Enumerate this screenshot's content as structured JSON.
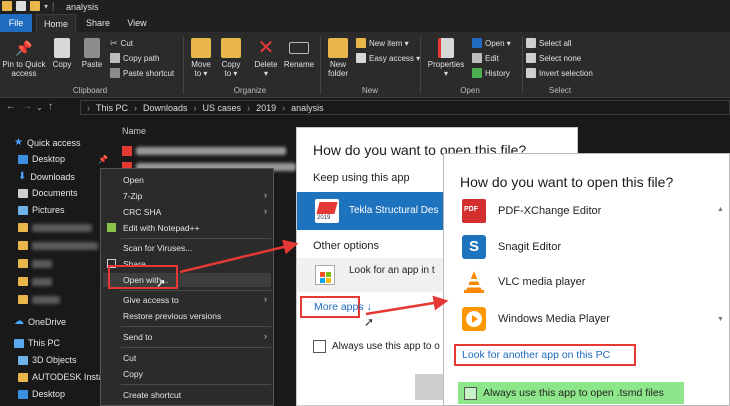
{
  "titlebar": {
    "title": "analysis"
  },
  "tabs": {
    "file": "File",
    "home": "Home",
    "share": "Share",
    "view": "View"
  },
  "ribbon": {
    "clipboard": {
      "pin": "Pin to Quick\naccess",
      "copy": "Copy",
      "paste": "Paste",
      "cut": "Cut",
      "copy_path": "Copy path",
      "paste_shortcut": "Paste shortcut",
      "group_label": "Clipboard"
    },
    "organize": {
      "move_to": "Move\nto ▾",
      "copy_to": "Copy\nto ▾",
      "delete": "Delete\n▾",
      "rename": "Rename",
      "group_label": "Organize"
    },
    "new": {
      "new_folder": "New\nfolder",
      "new_item": "New item ▾",
      "easy_access": "Easy access ▾",
      "group_label": "New"
    },
    "open": {
      "properties": "Properties\n▾",
      "open": "Open ▾",
      "edit": "Edit",
      "history": "History",
      "group_label": "Open"
    },
    "select": {
      "select_all": "Select all",
      "select_none": "Select none",
      "invert_selection": "Invert selection",
      "group_label": "Select"
    },
    "colors": {
      "accent": "#1e6bbf",
      "folder": "#e8b64a",
      "delete": "#e53935"
    }
  },
  "address": {
    "crumbs": [
      "This PC",
      "Downloads",
      "US cases",
      "2019",
      "analysis"
    ]
  },
  "navpane": {
    "quick_access": "Quick access",
    "desktop": "Desktop",
    "downloads": "Downloads",
    "documents": "Documents",
    "pictures": "Pictures",
    "onedrive": "OneDrive",
    "this_pc": "This PC",
    "objects3d": "3D Objects",
    "autodesk": "AUTODESK Install",
    "desktop2": "Desktop"
  },
  "filelist": {
    "name_header": "Name"
  },
  "context_menu": {
    "open": "Open",
    "zip": "7-Zip",
    "crc": "CRC SHA",
    "notepad": "Edit with Notepad++",
    "scan": "Scan for Viruses...",
    "share": "Share",
    "open_with": "Open with...",
    "give_access": "Give access to",
    "restore": "Restore previous versions",
    "send_to": "Send to",
    "cut": "Cut",
    "copy": "Copy",
    "create_shortcut": "Create shortcut"
  },
  "dialog1": {
    "title": "How do you want to open this file?",
    "keep_using": "Keep using this app",
    "app_name": "Tekla Structural Des",
    "app_badge": "2019",
    "other_options": "Other options",
    "look_for_app": "Look for an app in t",
    "more_apps": "More apps  ↓",
    "always_use": "Always use this app to o"
  },
  "dialog2": {
    "title": "How do you want to open this file?",
    "apps": [
      {
        "name": "PDF-XChange Editor",
        "icon": "pdf-xchange-icon",
        "badge": "PDF"
      },
      {
        "name": "Snagit Editor",
        "icon": "snagit-icon",
        "badge": "S"
      },
      {
        "name": "VLC media player",
        "icon": "vlc-icon",
        "badge": ""
      },
      {
        "name": "Windows Media Player",
        "icon": "windows-media-player-icon",
        "badge": ""
      }
    ],
    "look_another": "Look for another app on this PC",
    "always_use": "Always use this app to open .tsmd files"
  }
}
